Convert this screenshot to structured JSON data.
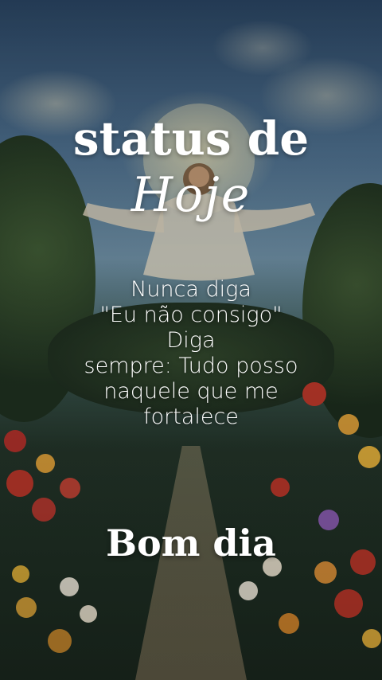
{
  "title": "status de",
  "subtitle": "Hoje",
  "message_lines": [
    "Nunca diga",
    "\"Eu não consigo\"",
    "Diga",
    "sempre: Tudo posso",
    "naquele que me",
    "fortalece"
  ],
  "greeting": "Bom dia",
  "colors": {
    "text": "#ffffff",
    "sky": "#4d6f8e",
    "foliage": "#24362a"
  }
}
